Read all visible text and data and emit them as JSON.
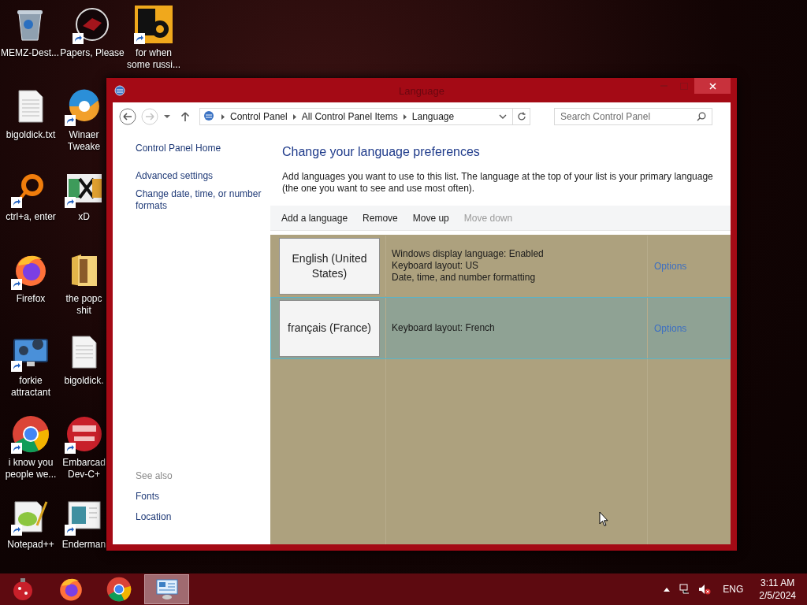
{
  "desktop_columns": [
    [
      {
        "label": "MEMZ-Dest...",
        "shortcut": false
      },
      {
        "label": "bigoldick.txt",
        "shortcut": false
      },
      {
        "label": "ctrl+a, enter",
        "shortcut": true
      },
      {
        "label": "Firefox",
        "shortcut": true
      },
      {
        "label": "forkie attractant",
        "shortcut": true
      },
      {
        "label": "i know you people we...",
        "shortcut": true
      },
      {
        "label": "Notepad++",
        "shortcut": true
      }
    ],
    [
      {
        "label": "Papers, Please",
        "shortcut": true
      },
      {
        "label": "Winaer Tweake",
        "shortcut": true
      },
      {
        "label": "xD",
        "shortcut": true
      },
      {
        "label": "the popc shit",
        "shortcut": false
      },
      {
        "label": "bigoldick.",
        "shortcut": false
      },
      {
        "label": "Embarcad Dev-C+",
        "shortcut": true
      },
      {
        "label": "Enderman",
        "shortcut": true
      }
    ],
    [
      {
        "label": "for when some russi...",
        "shortcut": true
      }
    ]
  ],
  "window": {
    "title": "Language",
    "address": {
      "back_disabled": false,
      "forward_disabled": true,
      "breadcrumb": [
        "Control Panel",
        "All Control Panel Items",
        "Language"
      ],
      "search_placeholder": "Search Control Panel"
    },
    "sidebar": {
      "links": [
        "Control Panel Home",
        "Advanced settings",
        "Change date, time, or number formats"
      ],
      "see_also_heading": "See also",
      "see_also": [
        "Fonts",
        "Location"
      ]
    },
    "heading": "Change your language preferences",
    "description": "Add languages you want to use to this list. The language at the top of your list is your primary language (the one you want to see and use most often).",
    "toolbar": [
      {
        "label": "Add a language",
        "disabled": false
      },
      {
        "label": "Remove",
        "disabled": false
      },
      {
        "label": "Move up",
        "disabled": false
      },
      {
        "label": "Move down",
        "disabled": true
      }
    ],
    "languages": [
      {
        "name": "English (United States)",
        "details": [
          "Windows display language: Enabled",
          "Keyboard layout: US",
          "Date, time, and number formatting"
        ],
        "options": "Options",
        "selected": false
      },
      {
        "name": "français (France)",
        "details": [
          "Keyboard layout: French"
        ],
        "options": "Options",
        "selected": true
      }
    ]
  },
  "taskbar": {
    "apps": [
      {
        "selected": false
      },
      {
        "selected": false
      },
      {
        "selected": false
      },
      {
        "selected": true
      }
    ],
    "language": "ENG",
    "time": "3:11 AM",
    "date": "2/5/2024"
  }
}
